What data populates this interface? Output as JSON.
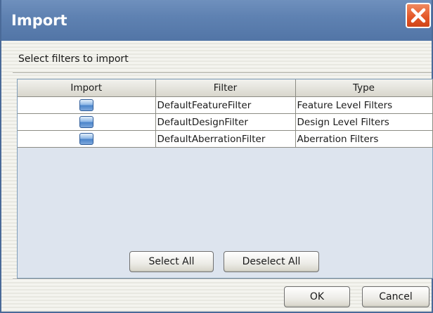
{
  "window": {
    "title": "Import"
  },
  "prompt": "Select filters to import",
  "table": {
    "columns": [
      "Import",
      "Filter",
      "Type"
    ],
    "rows": [
      {
        "checked": true,
        "filter": "DefaultFeatureFilter",
        "type": "Feature Level Filters"
      },
      {
        "checked": true,
        "filter": "DefaultDesignFilter",
        "type": "Design Level Filters"
      },
      {
        "checked": true,
        "filter": "DefaultAberrationFilter",
        "type": "Aberration Filters"
      }
    ]
  },
  "buttons": {
    "select_all": "Select All",
    "deselect_all": "Deselect All",
    "ok": "OK",
    "cancel": "Cancel"
  },
  "colors": {
    "titlebar": "#5f82b2",
    "close_button": "#e4592a",
    "checkbox": "#4c85cb"
  },
  "icons": {
    "close": "close-x-icon"
  }
}
